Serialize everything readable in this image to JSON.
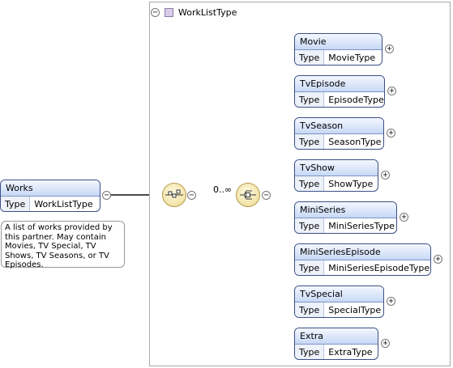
{
  "panel": {
    "title": "WorkListType",
    "toggle": "−"
  },
  "root": {
    "name": "Works",
    "type_key": "Type",
    "type_value": "WorkListType",
    "note": "A list of works provided by this partner. May contain Movies, TV Special, TV Shows, TV Seasons, or TV Episodes."
  },
  "sequence": {
    "occurrence": "0..∞"
  },
  "children": [
    {
      "name": "Movie",
      "type_key": "Type",
      "type_value": "MovieType"
    },
    {
      "name": "TvEpisode",
      "type_key": "Type",
      "type_value": "EpisodeType"
    },
    {
      "name": "TvSeason",
      "type_key": "Type",
      "type_value": "SeasonType"
    },
    {
      "name": "TvShow",
      "type_key": "Type",
      "type_value": "ShowType"
    },
    {
      "name": "MiniSeries",
      "type_key": "Type",
      "type_value": "MiniSeriesType"
    },
    {
      "name": "MiniSeriesEpisode",
      "type_key": "Type",
      "type_value": "MiniSeriesEpisodeType"
    },
    {
      "name": "TvSpecial",
      "type_key": "Type",
      "type_value": "SpecialType"
    },
    {
      "name": "Extra",
      "type_key": "Type",
      "type_value": "ExtraType"
    }
  ],
  "toggles": {
    "collapse": "−",
    "expand": "+"
  }
}
